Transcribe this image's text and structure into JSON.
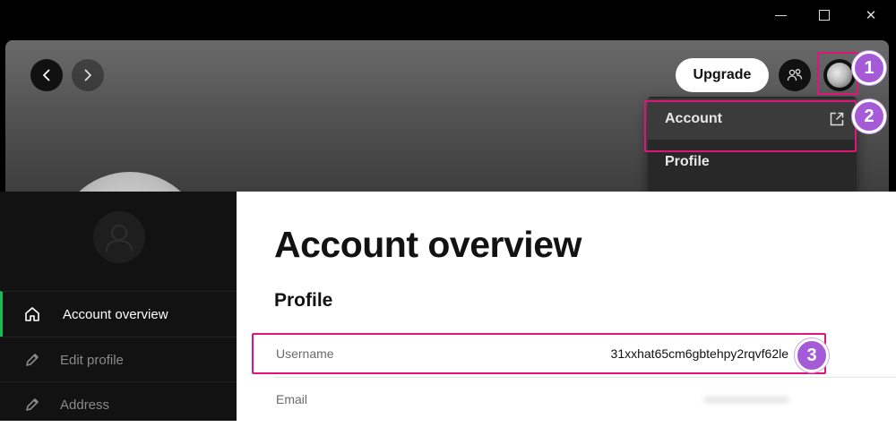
{
  "window": {
    "controls": [
      "minimize",
      "maximize",
      "close"
    ]
  },
  "header": {
    "upgrade_label": "Upgrade",
    "icons": [
      "chevron-left-icon",
      "chevron-right-icon",
      "friends-icon",
      "avatar"
    ]
  },
  "dropdown": {
    "items": [
      {
        "label": "Account",
        "icon": "external-link-icon"
      },
      {
        "label": "Profile"
      }
    ]
  },
  "callouts": [
    "1",
    "2",
    "3"
  ],
  "sidebar": {
    "items": [
      {
        "label": "Account overview",
        "icon": "home-icon",
        "active": true
      },
      {
        "label": "Edit profile",
        "icon": "pencil-icon"
      },
      {
        "label": "Address",
        "icon": "pencil-icon"
      }
    ]
  },
  "main": {
    "title": "Account overview",
    "section": "Profile",
    "rows": [
      {
        "label": "Username",
        "value": "31xxhat65cm6gbtehpy2rqvf62le"
      },
      {
        "label": "Email",
        "value": "•••••••••••••••••••"
      }
    ]
  },
  "colors": {
    "highlight": "#e0157c",
    "marker": "#a55bd8",
    "accent_green": "#1db954",
    "sidebar_bg": "#121212",
    "dropdown_bg": "#282828"
  }
}
